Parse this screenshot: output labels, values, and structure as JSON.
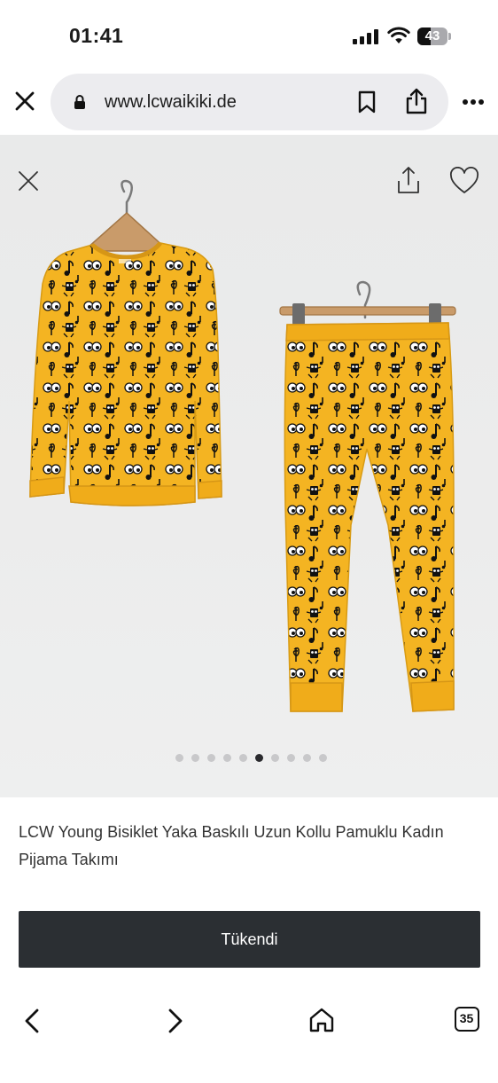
{
  "status_bar": {
    "time": "01:41",
    "battery_level": "43"
  },
  "browser": {
    "url": "www.lcwaikiki.de"
  },
  "gallery": {
    "image_count": 10,
    "active_index": 5,
    "product_color": "#f4b422"
  },
  "product": {
    "title": "LCW Young Bisiklet Yaka Baskılı Uzun Kollu Pamuklu Kadın Pijama Takımı",
    "button_label": "Tükendi"
  },
  "toolbar": {
    "tabs_count": "35"
  },
  "icons": [
    "close-icon",
    "lock-icon",
    "bookmark-icon",
    "share-icon",
    "more-icon",
    "heart-icon",
    "back-icon",
    "forward-icon",
    "home-icon",
    "tabs-icon"
  ]
}
